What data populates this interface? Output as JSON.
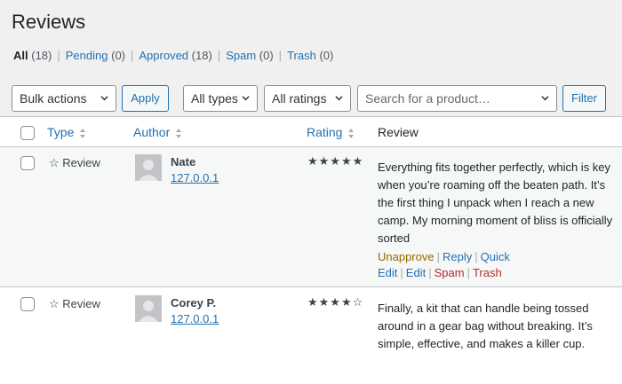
{
  "page": {
    "title": "Reviews"
  },
  "filters": [
    {
      "label": "All",
      "count": "(18)",
      "current": true
    },
    {
      "label": "Pending",
      "count": "(0)"
    },
    {
      "label": "Approved",
      "count": "(18)"
    },
    {
      "label": "Spam",
      "count": "(0)"
    },
    {
      "label": "Trash",
      "count": "(0)"
    }
  ],
  "toolbar": {
    "bulk_actions": "Bulk actions",
    "apply": "Apply",
    "all_types": "All types",
    "all_ratings": "All ratings",
    "product_search_placeholder": "Search for a product…",
    "filter": "Filter"
  },
  "table": {
    "columns": {
      "type": "Type",
      "author": "Author",
      "rating": "Rating",
      "review": "Review"
    },
    "rows": [
      {
        "type_icon": "star-outline-icon",
        "type": "☆ Review",
        "author": "Nate",
        "ip": "127.0.0.1",
        "stars": "★★★★★",
        "rating": 5,
        "review": "Everything fits together perfectly, which is key when you’re roaming off the beaten path. It’s the first thing I unpack when I reach a new camp. My morning moment of bliss is officially sorted",
        "actions": {
          "unapprove": "Unapprove",
          "reply": "Reply",
          "quick_edit": "Quick Edit",
          "edit": "Edit",
          "spam": "Spam",
          "trash": "Trash"
        }
      },
      {
        "type_icon": "star-outline-icon",
        "type": "☆ Review",
        "author": "Corey P.",
        "ip": "127.0.0.1",
        "stars": "★★★★☆",
        "rating": 4,
        "review": "Finally, a kit that can handle being tossed around in a gear bag without breaking. It’s simple, effective, and makes a killer cup."
      }
    ]
  },
  "colors": {
    "link": "#2271b1",
    "unapprove": "#996800",
    "danger": "#b32d2e",
    "row_highlight": "#f6f7f7"
  }
}
